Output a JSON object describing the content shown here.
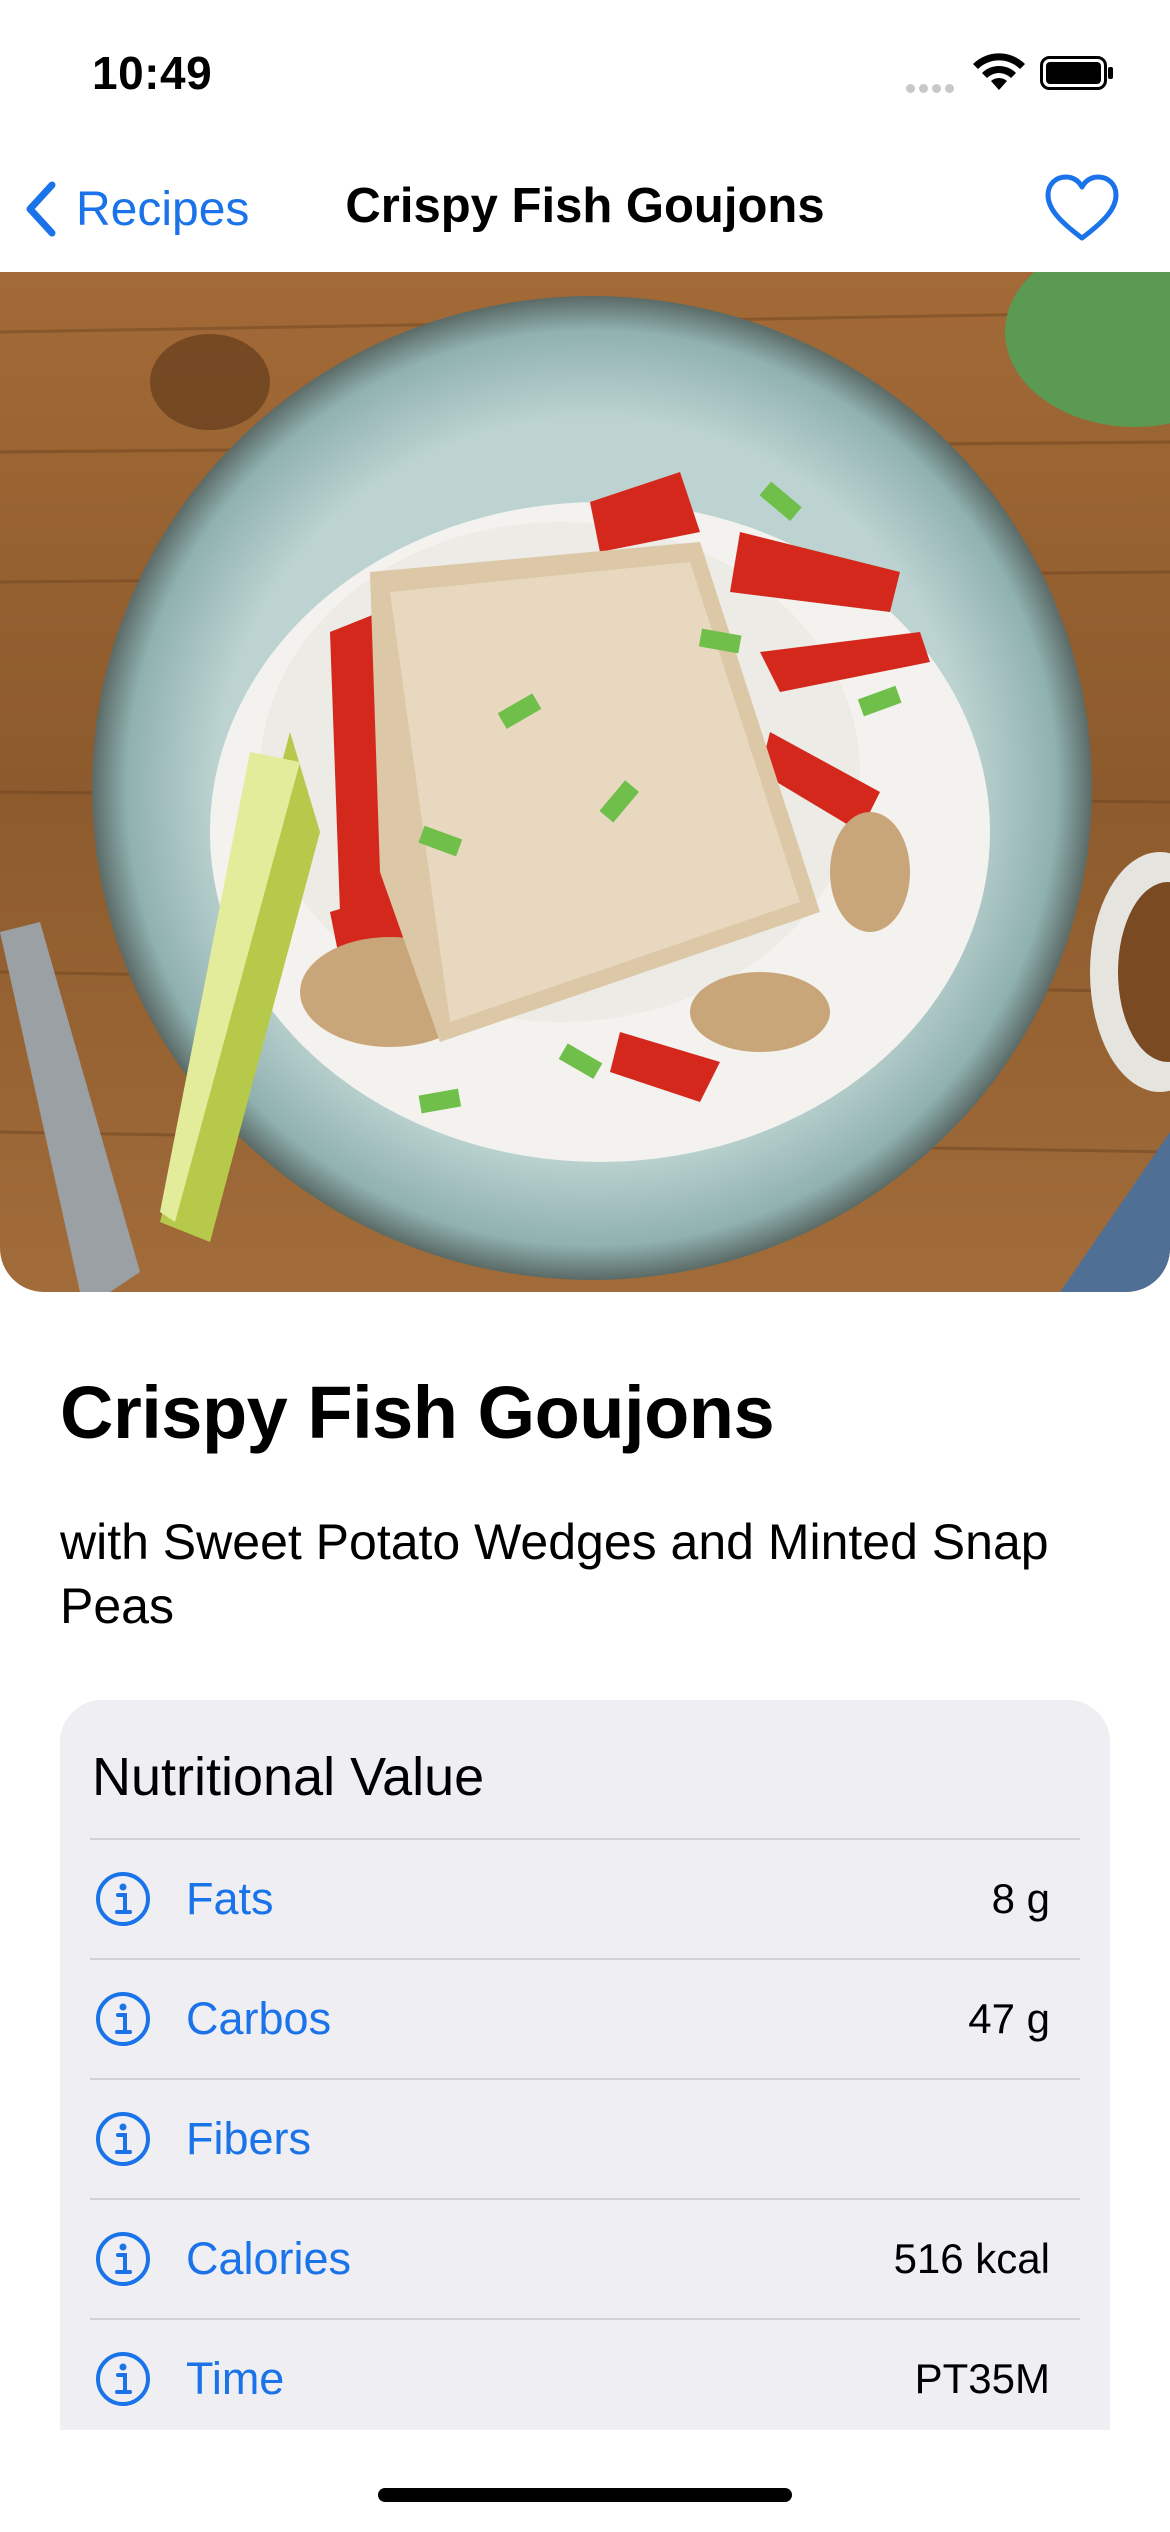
{
  "status_bar": {
    "time": "10:49"
  },
  "nav": {
    "back_label": "Recipes",
    "title": "Crispy Fish Goujons"
  },
  "recipe": {
    "title": "Crispy Fish Goujons",
    "subtitle": "with Sweet Potato Wedges and Minted Snap Peas"
  },
  "nutrition": {
    "header": "Nutritional Value",
    "rows": [
      {
        "label": "Fats",
        "value": "8 g",
        "icon": "info-icon"
      },
      {
        "label": "Carbos",
        "value": "47 g",
        "icon": "info-icon"
      },
      {
        "label": "Fibers",
        "value": "",
        "icon": "info-icon"
      },
      {
        "label": "Calories",
        "value": "516 kcal",
        "icon": "info-icon"
      },
      {
        "label": "Time",
        "value": "PT35M",
        "icon": "info-icon"
      }
    ]
  },
  "colors": {
    "accent": "#1a73e8",
    "card_bg": "#eeeef3",
    "separator": "#d1d1d6"
  }
}
